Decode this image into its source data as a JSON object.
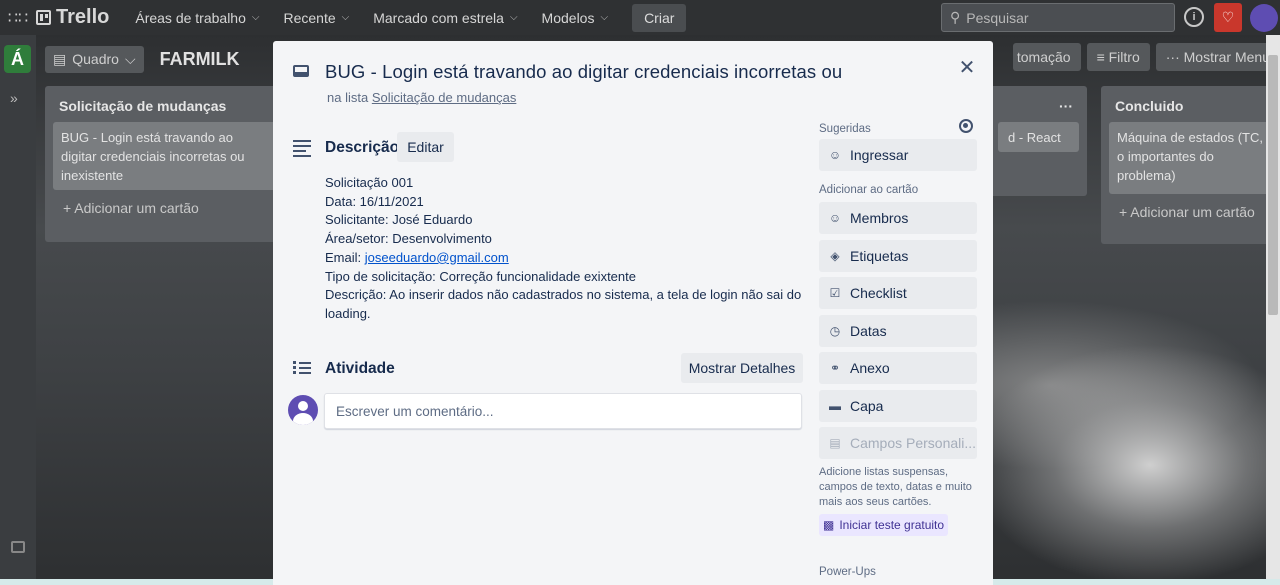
{
  "topnav": {
    "logo": "Trello",
    "items": [
      {
        "label": "Áreas de trabalho"
      },
      {
        "label": "Recente"
      },
      {
        "label": "Marcado com estrela"
      },
      {
        "label": "Modelos"
      }
    ],
    "create_label": "Criar",
    "search_placeholder": "Pesquisar"
  },
  "board": {
    "workspace_badge": "Á",
    "view_label": "Quadro",
    "name": "FARMILK",
    "right_buttons": {
      "automation": "tomação",
      "filter": "Filtro",
      "menu": "Mostrar Menu"
    },
    "lists": [
      {
        "title": "Solicitação de mudanças",
        "card_text": "BUG - Login está travando ao digitar credenciais incorretas ou inexistente",
        "add_card": "Adicionar um cartão"
      },
      {
        "title": "",
        "card_text": "d - React"
      },
      {
        "title": "Concluido",
        "card_text": "Máquina de estados (TC, o importantes do problema)",
        "add_card": "Adicionar um cartão"
      }
    ]
  },
  "modal": {
    "title": "BUG - Login está travando ao digitar credenciais incorretas ou",
    "list_prefix": "na lista",
    "list_name": "Solicitação de mudanças",
    "description": {
      "heading": "Descrição",
      "edit_label": "Editar",
      "lines": [
        "Solicitação 001",
        "Data: 16/11/2021",
        "Solicitante: José Eduardo",
        "Área/setor: Desenvolvimento",
        "Email: ",
        "Tipo de solicitação: Correção funcionalidade exixtente",
        "Descrição: Ao inserir dados não cadastrados no sistema, a tela de login não sai do loading."
      ],
      "email": "joseeduardo@gmail.com"
    },
    "activity": {
      "heading": "Atividade",
      "details_label": "Mostrar Detalhes",
      "comment_placeholder": "Escrever um comentário..."
    },
    "sidebar": {
      "suggested_label": "Sugeridas",
      "join_label": "Ingressar",
      "add_to_card_label": "Adicionar ao cartão",
      "buttons": [
        {
          "label": "Membros",
          "icon": "person-icon"
        },
        {
          "label": "Etiquetas",
          "icon": "tag-icon"
        },
        {
          "label": "Checklist",
          "icon": "checklist-icon"
        },
        {
          "label": "Datas",
          "icon": "clock-icon"
        },
        {
          "label": "Anexo",
          "icon": "paperclip-icon"
        },
        {
          "label": "Capa",
          "icon": "cover-icon"
        },
        {
          "label": "Campos Personali...",
          "icon": "custom-fields-icon"
        }
      ],
      "note": "Adicione listas suspensas, campos de texto, datas e muito mais aos seus cartões.",
      "trial_label": "Iniciar teste gratuito",
      "powerups_label": "Power-Ups"
    }
  }
}
